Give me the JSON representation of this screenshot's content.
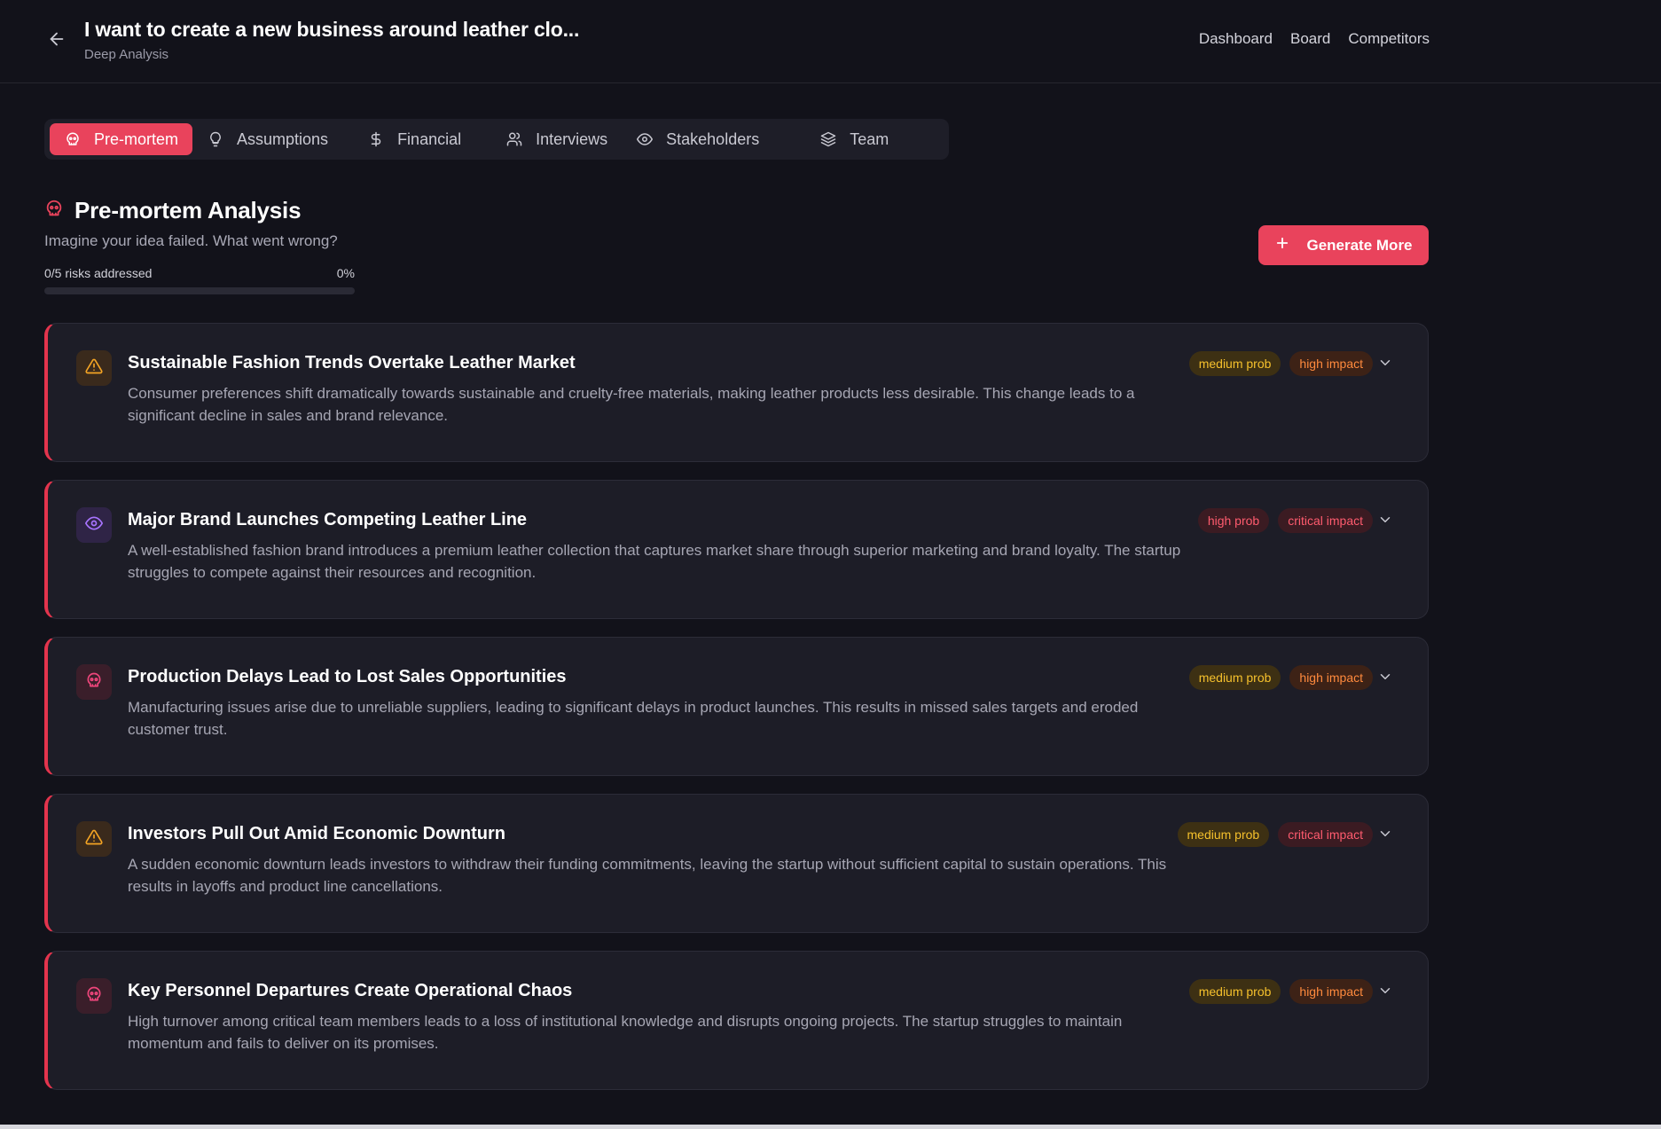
{
  "header": {
    "title": "I want to create a new business around leather clo...",
    "subtitle": "Deep Analysis",
    "nav": [
      "Dashboard",
      "Board",
      "Competitors"
    ]
  },
  "tabs": [
    {
      "label": "Pre-mortem",
      "icon": "skull-icon",
      "active": true
    },
    {
      "label": "Assumptions",
      "icon": "lightbulb-icon",
      "active": false
    },
    {
      "label": "Financial",
      "icon": "dollar-icon",
      "active": false
    },
    {
      "label": "Interviews",
      "icon": "users-icon",
      "active": false
    },
    {
      "label": "Stakeholders",
      "icon": "eye-icon",
      "active": false
    },
    {
      "label": "Team",
      "icon": "layers-icon",
      "active": false
    }
  ],
  "section": {
    "title": "Pre-mortem Analysis",
    "description": "Imagine your idea failed. What went wrong?",
    "progress_label": "0/5 risks addressed",
    "progress_percent_label": "0%",
    "progress_fraction": 0,
    "generate_button": "Generate More"
  },
  "colors": {
    "accent": "#e9435c",
    "background": "#12121a",
    "card": "#1d1d27",
    "medium_prob": "#f5c02c",
    "high_impact": "#ff8a3d",
    "critical": "#ff5b6e"
  },
  "risks": [
    {
      "icon": "warning-triangle-icon",
      "title": "Sustainable Fashion Trends Overtake Leather Market",
      "description": "Consumer preferences shift dramatically towards sustainable and cruelty-free materials, making leather products less desirable. This change leads to a significant decline in sales and brand relevance.",
      "probability": "medium prob",
      "impact": "high impact"
    },
    {
      "icon": "eye-icon",
      "title": "Major Brand Launches Competing Leather Line",
      "description": "A well-established fashion brand introduces a premium leather collection that captures market share through superior marketing and brand loyalty. The startup struggles to compete against their resources and recognition.",
      "probability": "high prob",
      "impact": "critical impact"
    },
    {
      "icon": "skull-icon",
      "title": "Production Delays Lead to Lost Sales Opportunities",
      "description": "Manufacturing issues arise due to unreliable suppliers, leading to significant delays in product launches. This results in missed sales targets and eroded customer trust.",
      "probability": "medium prob",
      "impact": "high impact"
    },
    {
      "icon": "warning-triangle-icon",
      "title": "Investors Pull Out Amid Economic Downturn",
      "description": "A sudden economic downturn leads investors to withdraw their funding commitments, leaving the startup without sufficient capital to sustain operations. This results in layoffs and product line cancellations.",
      "probability": "medium prob",
      "impact": "critical impact"
    },
    {
      "icon": "skull-icon",
      "title": "Key Personnel Departures Create Operational Chaos",
      "description": "High turnover among critical team members leads to a loss of institutional knowledge and disrupts ongoing projects. The startup struggles to maintain momentum and fails to deliver on its promises.",
      "probability": "medium prob",
      "impact": "high impact"
    }
  ]
}
